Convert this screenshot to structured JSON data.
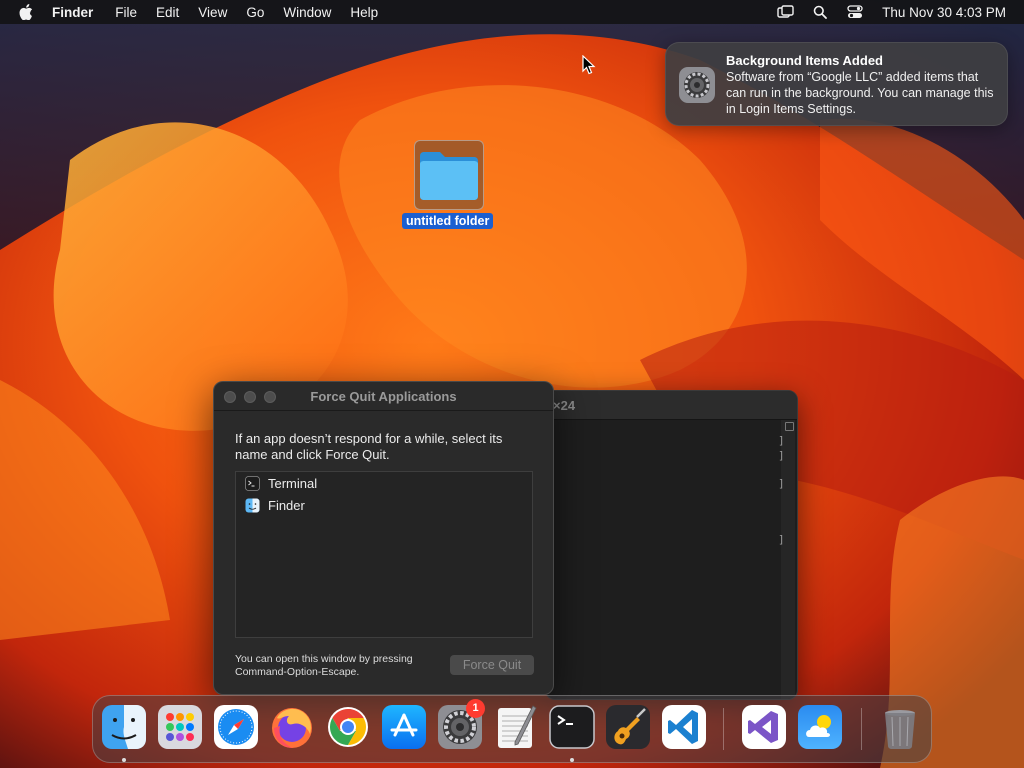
{
  "menubar": {
    "app_name": "Finder",
    "menus": [
      "File",
      "Edit",
      "View",
      "Go",
      "Window",
      "Help"
    ],
    "status_icons": [
      "screen-mirroring-icon",
      "spotlight-search-icon",
      "control-center-icon"
    ],
    "clock": "Thu Nov 30  4:03 PM"
  },
  "notification": {
    "icon": "system-settings-gear-icon",
    "title": "Background Items Added",
    "body": "Software from “Google LLC” added items that can run in the background. You can manage this in Login Items Settings."
  },
  "desktop": {
    "folder_label": "untitled folder"
  },
  "terminal_window": {
    "title_fragment": "×24"
  },
  "force_quit": {
    "title": "Force Quit Applications",
    "instructions": "If an app doesn’t respond for a while, select its name and click Force Quit.",
    "apps": [
      {
        "name": "Terminal",
        "icon": "terminal-icon"
      },
      {
        "name": "Finder",
        "icon": "finder-icon"
      }
    ],
    "hint": "You can open this window by pressing Command-Option-Escape.",
    "button": "Force Quit"
  },
  "dock": {
    "items": [
      {
        "name": "Finder",
        "running": true
      },
      {
        "name": "Launchpad",
        "running": false
      },
      {
        "name": "Safari",
        "running": false
      },
      {
        "name": "Firefox",
        "running": false
      },
      {
        "name": "Google Chrome",
        "running": false
      },
      {
        "name": "App Store",
        "running": false
      },
      {
        "name": "System Settings",
        "running": false,
        "badge": "1"
      },
      {
        "name": "TextEdit",
        "running": false
      },
      {
        "name": "Terminal",
        "running": true
      },
      {
        "name": "GarageBand",
        "running": false
      },
      {
        "name": "Visual Studio Code",
        "running": false
      },
      {
        "name": "Visual Studio",
        "running": false
      },
      {
        "name": "Weather",
        "running": false
      },
      {
        "name": "Trash",
        "running": false
      }
    ]
  },
  "colors": {
    "selection_blue": "#1b5fd0",
    "badge_red": "#ff3b30",
    "folder_blue": "#3aa8ee"
  }
}
